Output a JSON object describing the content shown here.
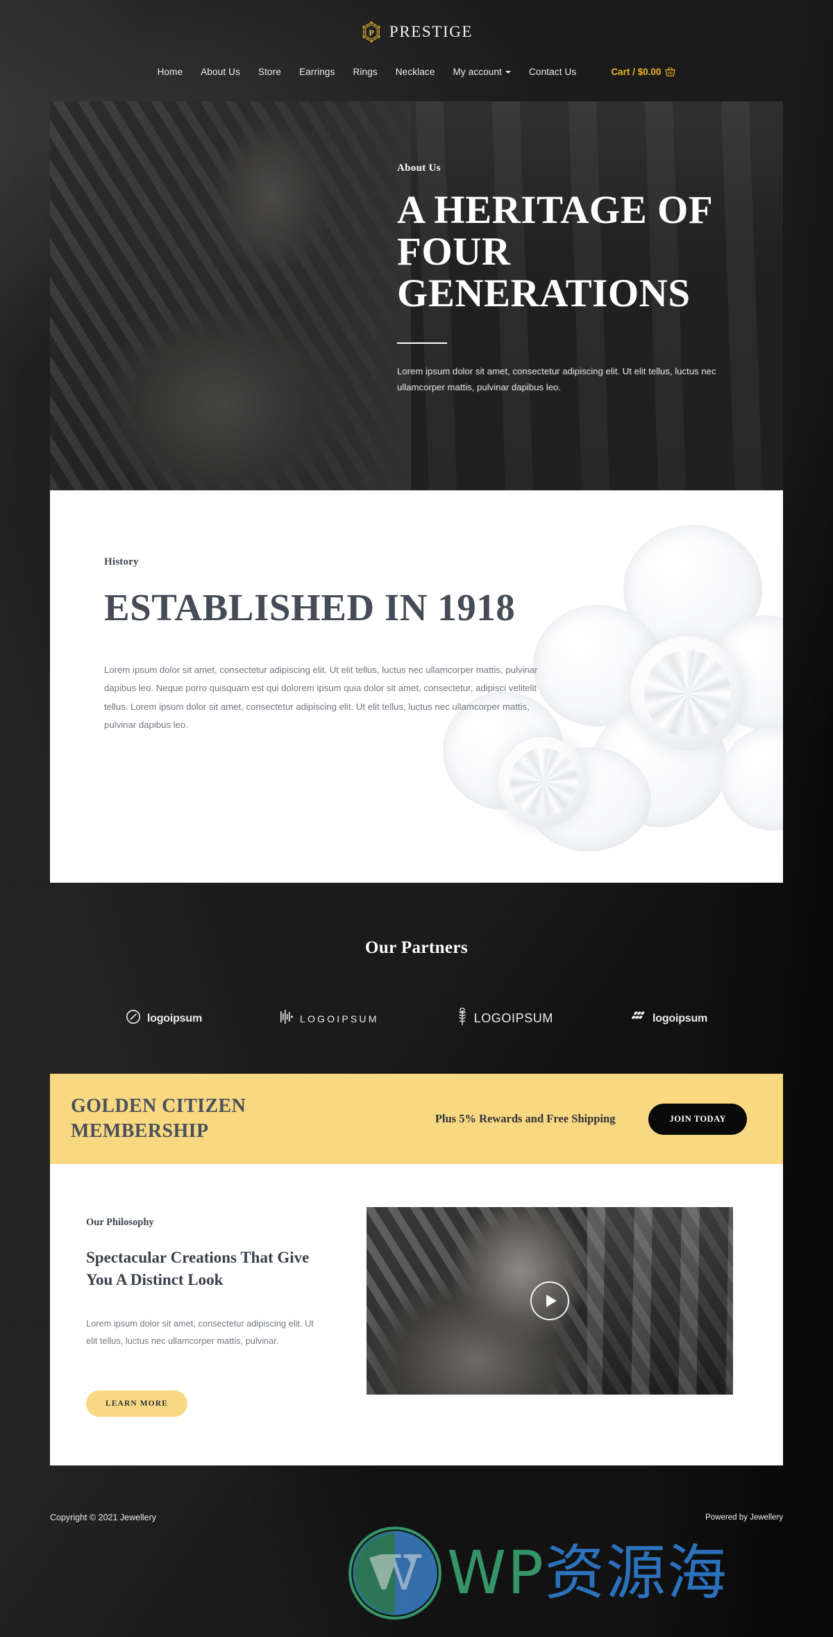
{
  "header": {
    "logo": {
      "badge_letter": "P",
      "word": "PRESTIGE",
      "badge_icon": "hexagon-laurel-badge-icon"
    },
    "nav": [
      {
        "label": "Home",
        "has_dropdown": false
      },
      {
        "label": "About Us",
        "has_dropdown": false
      },
      {
        "label": "Store",
        "has_dropdown": false
      },
      {
        "label": "Earrings",
        "has_dropdown": false
      },
      {
        "label": "Rings",
        "has_dropdown": false
      },
      {
        "label": "Necklace",
        "has_dropdown": false
      },
      {
        "label": "My account",
        "has_dropdown": true
      },
      {
        "label": "Contact Us",
        "has_dropdown": false
      }
    ],
    "cart": {
      "label": "Cart / $0.00",
      "icon": "shopping-basket-icon",
      "color": "#edb626"
    }
  },
  "hero": {
    "eyebrow": "About Us",
    "title": "A HERITAGE OF FOUR GENERATIONS",
    "description": "Lorem ipsum dolor sit amet, consectetur adipiscing elit. Ut elit tellus, luctus nec ullamcorper mattis, pulvinar dapibus leo."
  },
  "history": {
    "eyebrow": "History",
    "title": "ESTABLISHED IN 1918",
    "body": "Lorem ipsum dolor sit amet, consectetur adipiscing elit. Ut elit tellus, luctus nec ullamcorper mattis, pulvinar dapibus leo. Neque porro quisquam est qui dolorem ipsum quia dolor sit amet, consectetur, adipisci velitelit tellus. Lorem ipsum dolor sit amet, consectetur adipiscing elit. Ut elit tellus, luctus nec ullamcorper mattis, pulvinar dapibus leo."
  },
  "partners": {
    "title": "Our Partners",
    "logos": [
      {
        "text": "logoipsum",
        "icon": "circle-swirl-icon"
      },
      {
        "text": "LOGOIPSUM",
        "icon": "sound-bars-icon"
      },
      {
        "text": "LOGOIPSUM",
        "icon": "wheat-stalk-icon"
      },
      {
        "text": "logoipsum",
        "icon": "dotted-slash-icon"
      }
    ]
  },
  "membership": {
    "title": "GOLDEN CITIZEN MEMBERSHIP",
    "subtitle": "Plus 5% Rewards and Free Shipping",
    "cta": "JOIN TODAY",
    "background_color": "#f9d882"
  },
  "philosophy": {
    "eyebrow": "Our Philosophy",
    "title": "Spectacular Creations That Give You A Distinct Look",
    "body": "Lorem ipsum dolor sit amet, consectetur adipiscing elit. Ut elit tellus, luctus nec ullamcorper mattis, pulvinar.",
    "cta": "LEARN MORE",
    "video": {
      "play_icon": "play-button-icon"
    }
  },
  "footer": {
    "copyright": "Copyright © 2021 Jewellery",
    "powered_by": "Powered by Jewellery"
  },
  "watermark": {
    "english": "WP",
    "chinese": "资源海",
    "logo_icon": "wordpress-logo-icon",
    "english_color": "#3aa875",
    "chinese_color": "#2f7fd4"
  }
}
